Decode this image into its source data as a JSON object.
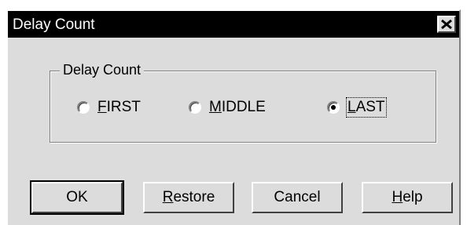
{
  "window": {
    "title": "Delay Count"
  },
  "group": {
    "label": "Delay Count",
    "options": [
      {
        "label_first": "F",
        "label_rest": "IRST",
        "selected": false
      },
      {
        "label_first": "M",
        "label_rest": "IDDLE",
        "selected": false
      },
      {
        "label_first": "L",
        "label_rest": "AST",
        "selected": true
      }
    ]
  },
  "buttons": {
    "ok": "OK",
    "restore_first": "R",
    "restore_rest": "estore",
    "cancel": "Cancel",
    "help_first": "H",
    "help_rest": "elp"
  }
}
